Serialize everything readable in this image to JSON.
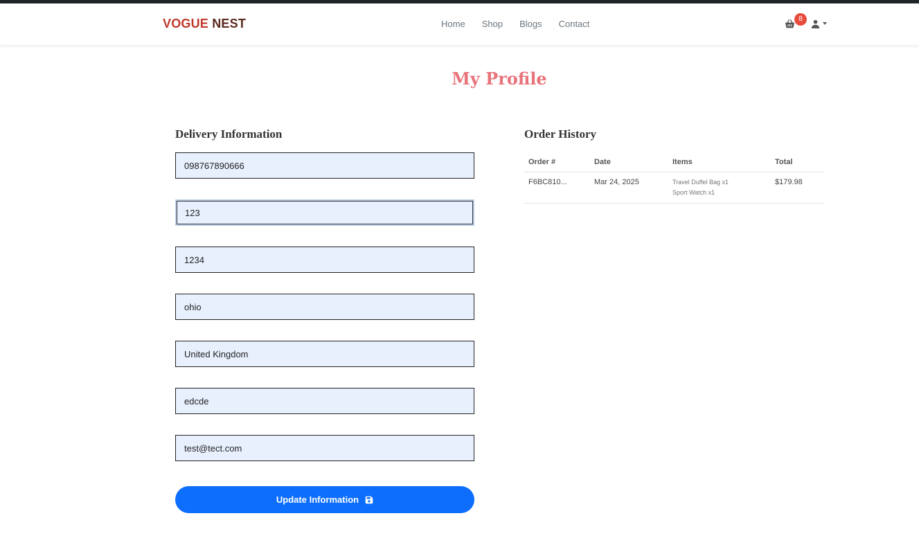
{
  "brand": {
    "part1": "VOGUE",
    "part2": "NEST"
  },
  "nav": {
    "links": [
      "Home",
      "Shop",
      "Blogs",
      "Contact"
    ]
  },
  "cart": {
    "count": "8",
    "icon": "basket-icon"
  },
  "user": {
    "icon": "user-icon"
  },
  "page": {
    "title": "My Profile"
  },
  "delivery": {
    "title": "Delivery Information",
    "fields": [
      {
        "value": "098767890666"
      },
      {
        "value": "123"
      },
      {
        "value": "1234"
      },
      {
        "value": "ohio"
      },
      {
        "value": "United Kingdom"
      },
      {
        "value": "edcde"
      },
      {
        "value": "test@tect.com"
      }
    ],
    "button_label": "Update Information",
    "button_icon": "save-icon"
  },
  "history": {
    "title": "Order History",
    "columns": [
      "Order #",
      "Date",
      "Items",
      "Total"
    ],
    "rows": [
      {
        "order": "F6BC810...",
        "date": "Mar 24, 2025",
        "items": [
          "Travel Duffel Bag x1",
          "Sport Watch x1"
        ],
        "total": "$179.98"
      }
    ]
  },
  "colors": {
    "accent": "#0d6efd",
    "title": "#e8737b",
    "brand_red": "#c0392b",
    "badge": "#e74c3c"
  }
}
